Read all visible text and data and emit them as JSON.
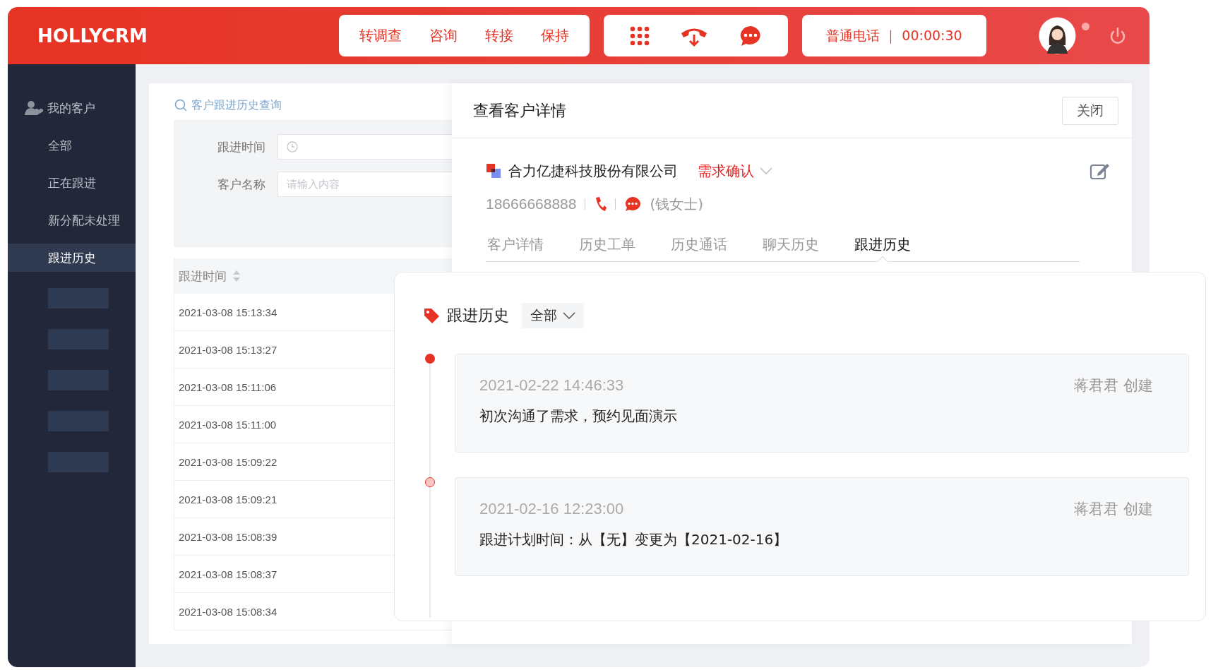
{
  "header": {
    "logo": "HOLLYCRM",
    "call_actions": [
      "转调查",
      "咨询",
      "转接",
      "保持"
    ],
    "call_status": "普通电话 ｜ 00:00:30",
    "has_notification": true
  },
  "sidebar": {
    "section": "我的客户",
    "items": [
      {
        "label": "全部",
        "selected": false
      },
      {
        "label": "正在跟进",
        "selected": false
      },
      {
        "label": "新分配未处理",
        "selected": false
      },
      {
        "label": "跟进历史",
        "selected": true
      }
    ]
  },
  "query": {
    "title": "客户跟进历史查询",
    "fields": [
      {
        "label": "跟进时间",
        "kind": "date"
      },
      {
        "label": "客户名称",
        "kind": "text",
        "placeholder": "请输入内容"
      }
    ]
  },
  "table": {
    "columns": [
      {
        "label": "跟进时间",
        "sortable": true
      }
    ],
    "rows": [
      "2021-03-08 15:13:34",
      "2021-03-08 15:13:27",
      "2021-03-08 15:11:06",
      "2021-03-08 15:11:00",
      "2021-03-08 15:09:22",
      "2021-03-08 15:09:21",
      "2021-03-08 15:08:39",
      "2021-03-08 15:08:37",
      "2021-03-08 15:08:34"
    ]
  },
  "detail": {
    "title": "查看客户详情",
    "close_button": "关闭",
    "company": "合力亿捷科技股份有限公司",
    "stage": "需求确认",
    "phone": "18666668888",
    "contact": "(钱女士)",
    "tabs": [
      {
        "label": "客户详情",
        "selected": false
      },
      {
        "label": "历史工单",
        "selected": false
      },
      {
        "label": "历史通话",
        "selected": false
      },
      {
        "label": "聊天历史",
        "selected": false
      },
      {
        "label": "跟进历史",
        "selected": true
      }
    ]
  },
  "follow_up": {
    "title": "跟进历史",
    "filter": "全部",
    "entries": [
      {
        "time": "2021-02-22 14:46:33",
        "author": "蒋君君 创建",
        "text": "初次沟通了需求，预约见面演示",
        "latest": true
      },
      {
        "time": "2021-02-16 12:23:00",
        "author": "蒋君君 创建",
        "text": "跟进计划时间：从【无】变更为【2021-02-16】",
        "latest": false
      }
    ]
  }
}
